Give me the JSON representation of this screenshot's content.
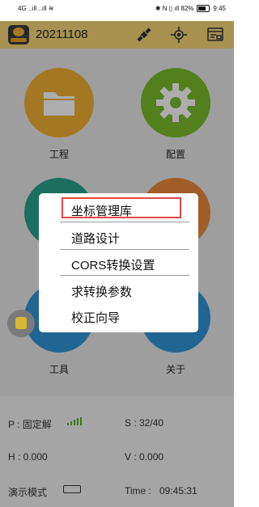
{
  "status_bar": {
    "left_text": "4G ..ıll ..ıll ≋",
    "right_text": "✱ N ▯ ıll 82%",
    "time": "9:45"
  },
  "app_bar": {
    "project_id": "20211108",
    "icons": [
      "satellite-icon",
      "crosshair-icon",
      "monitor-icon"
    ]
  },
  "tiles": [
    {
      "label": "工程",
      "color": "#f2b233",
      "icon": "folder-icon"
    },
    {
      "label": "配置",
      "color": "#7dbb2b",
      "icon": "gear-icon"
    },
    {
      "label": "",
      "color": "#2aa48c",
      "icon": ""
    },
    {
      "label": "",
      "color": "#ee8a3c",
      "icon": ""
    },
    {
      "label": "工具",
      "color": "#3296d8",
      "icon": "toolbox-icon"
    },
    {
      "label": "关于",
      "color": "#3296d8",
      "icon": "info-icon"
    }
  ],
  "menu": {
    "items": [
      "坐标管理库",
      "道路设计",
      "CORS转换设置",
      "求转换参数",
      "校正向导"
    ],
    "highlighted_index": 0,
    "highlight_color": "#e3464b"
  },
  "panel": {
    "solution": "P : 固定解",
    "satellites": "S : 32/40",
    "h_precision": "H : 0.000",
    "v_precision": "V : 0.000",
    "mode": "演示模式",
    "time_label": "Time :",
    "time_value": "09:45:31",
    "signal_color": "#5aae2b"
  }
}
